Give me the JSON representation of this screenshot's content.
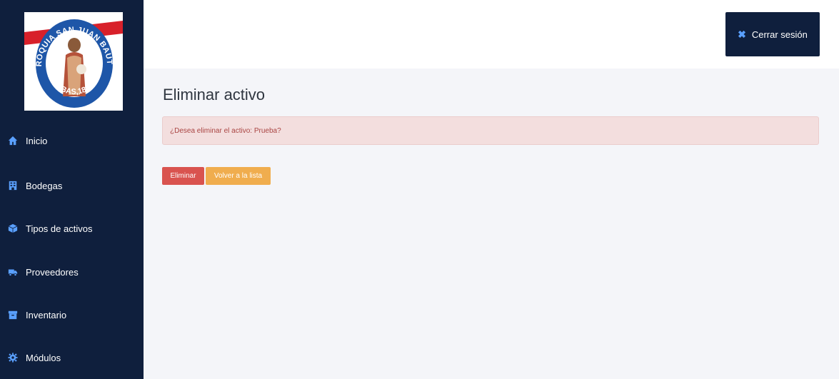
{
  "logo": {
    "text_top": "PARROQUIA SAN JUAN BAUTISTA",
    "text_bottom": "TIBAS,1865"
  },
  "sidebar": {
    "items": [
      {
        "label": "Inicio",
        "icon": "home-icon"
      },
      {
        "label": "Bodegas",
        "icon": "building-icon"
      },
      {
        "label": "Tipos de activos",
        "icon": "cube-icon"
      },
      {
        "label": "Proveedores",
        "icon": "truck-icon"
      },
      {
        "label": "Inventario",
        "icon": "archive-icon"
      },
      {
        "label": "Módulos",
        "icon": "gear-icon"
      }
    ]
  },
  "header": {
    "logout_label": "Cerrar sesión",
    "logout_icon": "close-icon"
  },
  "main": {
    "title": "Eliminar activo",
    "alert_text": "¿Desea eliminar el activo: Prueba?",
    "delete_label": "Eliminar",
    "back_label": "Volver a la lista"
  },
  "colors": {
    "sidebar_bg": "#0f1f3d",
    "icon_accent": "#5aa0ff",
    "danger": "#d9534f",
    "warning": "#f0ad4e",
    "alert_bg": "#f3dede"
  }
}
